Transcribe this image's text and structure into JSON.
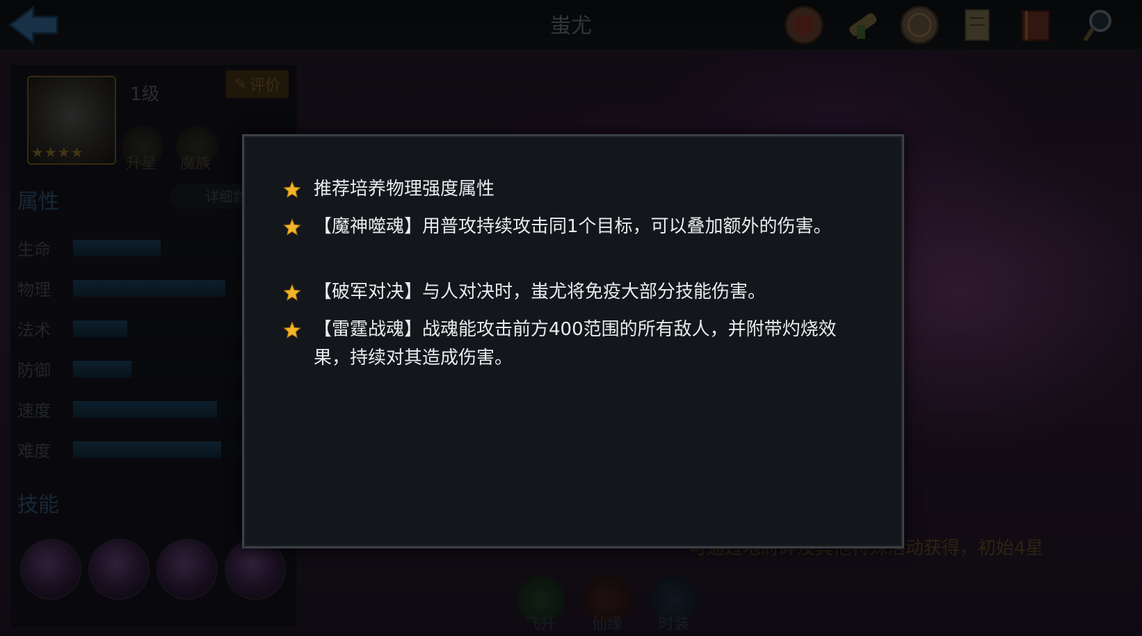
{
  "header": {
    "title": "蚩尤"
  },
  "hero": {
    "level": "1级",
    "rate_label": "评价",
    "star_count": 4,
    "upgrade_label": "升星",
    "race_label": "魔族"
  },
  "attributes": {
    "title": "属性",
    "detail_label": "详细数",
    "stats": [
      {
        "label": "生命",
        "value": 0.42
      },
      {
        "label": "物理",
        "value": 0.73
      },
      {
        "label": "法术",
        "value": 0.26
      },
      {
        "label": "防御",
        "value": 0.28
      },
      {
        "label": "速度",
        "value": 0.69
      },
      {
        "label": "难度",
        "value": 0.71
      }
    ]
  },
  "skills": {
    "title": "技能"
  },
  "bottom_nav": {
    "ascend_label": "飞升",
    "fate_label": "仙缘",
    "costume_label": "时装"
  },
  "obtain_text": "可通过地府碎及其他特殊活动获得，初始4星",
  "tips": [
    "推荐培养物理强度属性",
    "【魔神噬魂】用普攻持续攻击同1个目标，可以叠加额外的伤害。",
    "【破军对决】与人对决时，蚩尤将免疫大部分技能伤害。",
    "【雷霆战魂】战魂能攻击前方400范围的所有敌人，并附带灼烧效果，持续对其造成伤害。"
  ],
  "colors": {
    "accent_gold": "#f1b52a",
    "bar_blue": "#1a3a52"
  }
}
